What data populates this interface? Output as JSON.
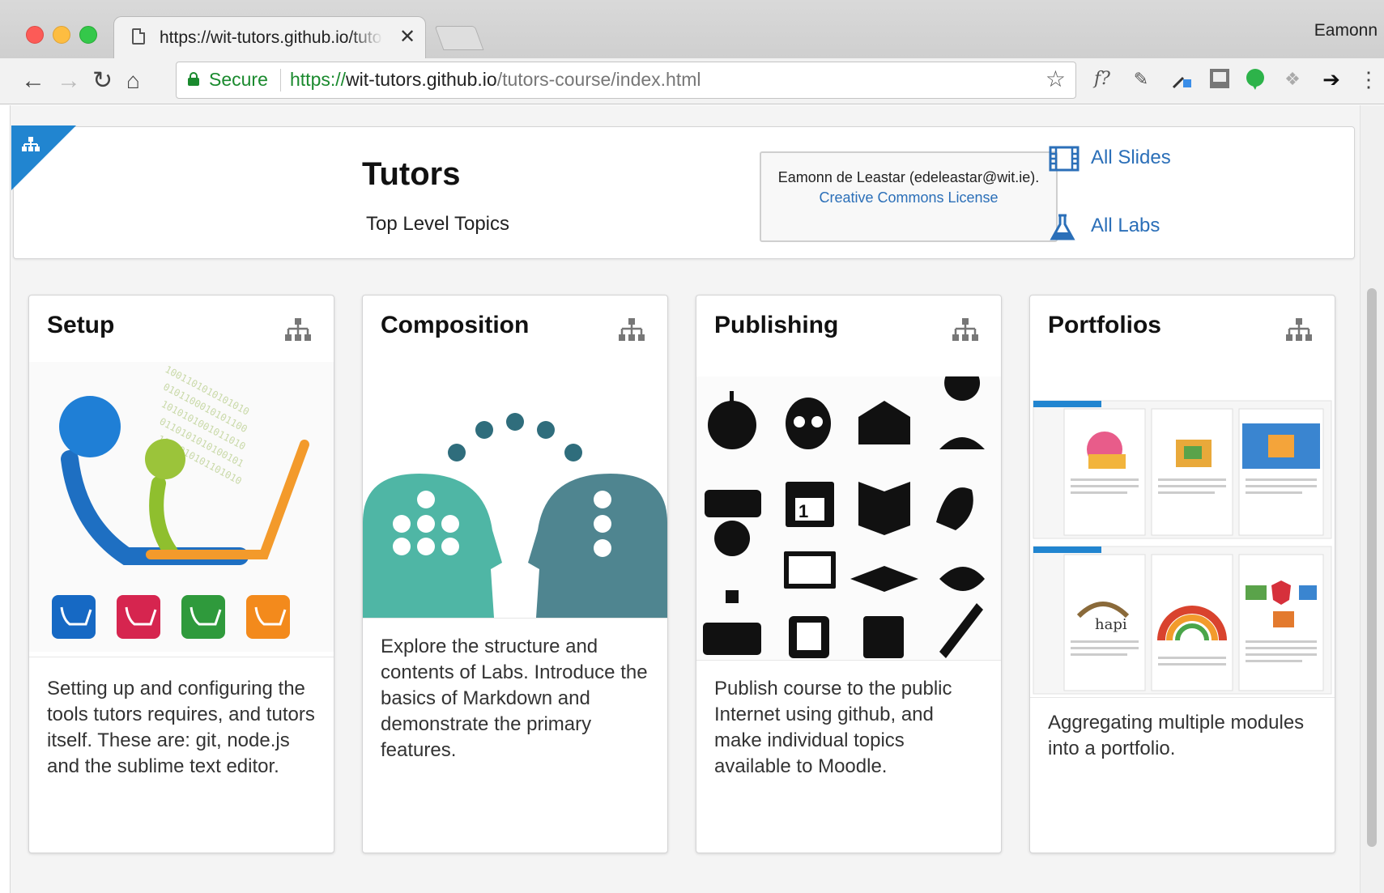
{
  "browser": {
    "tab_title": "https://wit-tutors.github.io/tutors-course/index.html",
    "profile_name": "Eamonn",
    "secure_label": "Secure",
    "url_scheme": "https://",
    "url_host": "wit-tutors.github.io",
    "url_path": "/tutors-course/index.html",
    "extensions": [
      "f?",
      "brush-icon",
      "dropper-icon",
      "jb-icon",
      "evernote-icon",
      "dropbox-icon",
      "arrow-icon",
      "menu-icon"
    ]
  },
  "header": {
    "title": "Tutors",
    "subtitle": "Top Level Topics",
    "author_text": "Eamonn de Leastar (edeleastar@wit.ie).",
    "license_link": "Creative Commons License",
    "slides_link": "All Slides",
    "labs_link": "All Labs"
  },
  "topics": [
    {
      "title": "Setup",
      "description": "Setting up and configuring the tools tutors requires, and tutors itself. These are: git, node.js and the sublime text editor."
    },
    {
      "title": "Composition",
      "description": "Explore the structure and contents of Labs. Introduce the basics of Markdown and demonstrate the primary features."
    },
    {
      "title": "Publishing",
      "description": "Publish course to the public Internet using github, and make individual topics available to Moodle."
    },
    {
      "title": "Portfolios",
      "description": "Aggregating multiple modules into a portfolio."
    }
  ],
  "colors": {
    "accent": "#2185d0",
    "link": "#2b6fb8",
    "secure_green": "#1a8a2e"
  }
}
